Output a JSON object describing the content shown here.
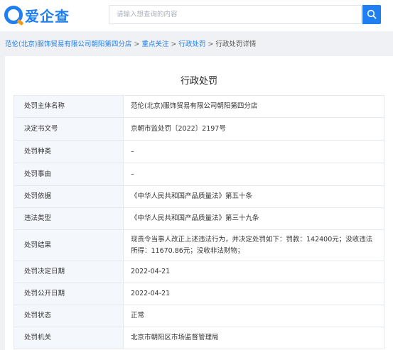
{
  "header": {
    "logo_text": "爱企查",
    "search_placeholder": "请输入想查询的内容",
    "brand_color": "#1f7ff0",
    "search_icon": "search-icon"
  },
  "breadcrumb": {
    "items": [
      "范伦(北京)服饰贸易有限公司朝阳第四分店",
      "重点关注",
      "行政处罚",
      "行政处罚详情"
    ],
    "separator": ">"
  },
  "panel": {
    "title": "行政处罚",
    "rows": [
      {
        "key": "处罚主体名称",
        "value": "范伦(北京)服饰贸易有限公司朝阳第四分店"
      },
      {
        "key": "决定书文号",
        "value": "京朝市监处罚〔2022〕2197号"
      },
      {
        "key": "处罚种类",
        "value": "–"
      },
      {
        "key": "处罚事由",
        "value": "–"
      },
      {
        "key": "处罚依据",
        "value": "《中华人民共和国产品质量法》第五十条"
      },
      {
        "key": "违法类型",
        "value": "《中华人民共和国产品质量法》第三十九条"
      },
      {
        "key": "处罚结果",
        "value": "现责令当事人改正上述违法行为，并决定处罚如下：罚款：142400元；没收违法所得：11670.86元；没收非法财物；"
      },
      {
        "key": "处罚决定日期",
        "value": "2022-04-21"
      },
      {
        "key": "处罚公开日期",
        "value": "2022-04-21"
      },
      {
        "key": "处罚状态",
        "value": "正常"
      },
      {
        "key": "处罚机关",
        "value": "北京市朝阳区市场监督管理局"
      }
    ]
  }
}
